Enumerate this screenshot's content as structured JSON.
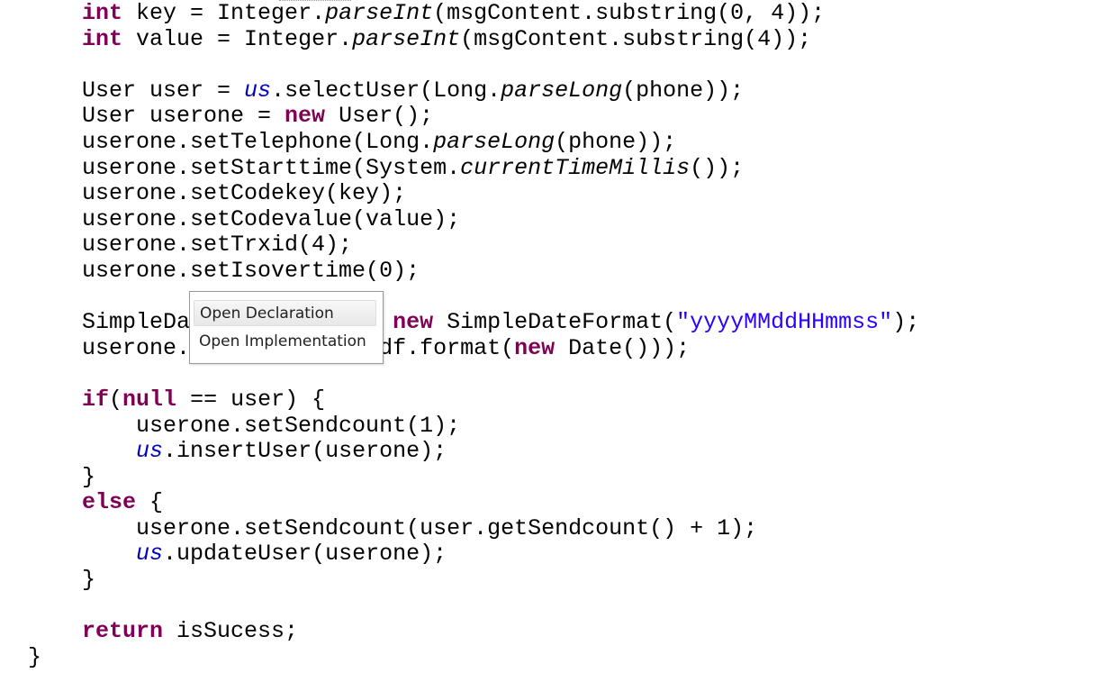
{
  "code_lines": [
    [
      [
        "kw",
        "int"
      ],
      [
        "",
        "    key = Integer."
      ],
      [
        "static",
        "parseInt"
      ],
      [
        "",
        "(msgContent.substring(0, 4));"
      ]
    ],
    [
      [
        "",
        "    "
      ],
      [
        "kw",
        "int"
      ],
      [
        "",
        " value = Integer."
      ],
      [
        "static",
        "parseInt"
      ],
      [
        "",
        "(msgContent.substring(4));"
      ]
    ],
    [],
    [
      [
        "",
        "    User user = "
      ],
      [
        "field",
        "us"
      ],
      [
        "",
        ".selectUser(Long."
      ],
      [
        "static",
        "parseLong"
      ],
      [
        "",
        "(phone));"
      ]
    ],
    [
      [
        "",
        "    User userone = "
      ],
      [
        "kw",
        "new"
      ],
      [
        "",
        " User();"
      ]
    ],
    [
      [
        "",
        "    userone.setTelephone(Long."
      ],
      [
        "static",
        "parseLong"
      ],
      [
        "",
        "(phone));"
      ]
    ],
    [
      [
        "",
        "    userone.setStarttime(System."
      ],
      [
        "static",
        "currentTimeMillis"
      ],
      [
        "",
        "());"
      ]
    ],
    [
      [
        "",
        "    userone.setCodekey(key);"
      ]
    ],
    [
      [
        "",
        "    userone.setCodevalue(value);"
      ]
    ],
    [
      [
        "",
        "    userone.setTrxid(4);"
      ]
    ],
    [
      [
        "",
        "    userone.setIsovertime(0);"
      ]
    ],
    [],
    [
      [
        "",
        "    SimpleDateFormat sdf = "
      ],
      [
        "kw",
        "new"
      ],
      [
        "",
        " SimpleDateFormat("
      ],
      [
        "str",
        "\"yyyyMMddHHmmss\""
      ],
      [
        "",
        ");"
      ]
    ],
    [
      [
        "",
        "    userone.setStarttime(sdf.format("
      ],
      [
        "kw",
        "new"
      ],
      [
        "",
        " Date()));"
      ]
    ],
    [],
    [
      [
        "",
        "    "
      ],
      [
        "kw",
        "if"
      ],
      [
        "",
        "("
      ],
      [
        "kw",
        "null"
      ],
      [
        "",
        " == user) {"
      ]
    ],
    [
      [
        "",
        "        userone.setSendcount(1);"
      ]
    ],
    [
      [
        "",
        "        "
      ],
      [
        "field",
        "us"
      ],
      [
        "",
        ".insertUser(userone);"
      ]
    ],
    [
      [
        "",
        "    }"
      ]
    ],
    [
      [
        "",
        "    "
      ],
      [
        "kw",
        "else"
      ],
      [
        "",
        " {"
      ]
    ],
    [
      [
        "",
        "        userone.setSendcount(user.getSendcount() + 1);"
      ]
    ],
    [
      [
        "",
        "        "
      ],
      [
        "field",
        "us"
      ],
      [
        "",
        ".updateUser(userone);"
      ]
    ],
    [
      [
        "",
        "    }"
      ]
    ],
    [],
    [
      [
        "",
        "    "
      ],
      [
        "kw",
        "return"
      ],
      [
        "",
        " isSucess;"
      ]
    ],
    [
      [
        "",
        "}"
      ]
    ]
  ],
  "context_menu": {
    "items": [
      {
        "label": "Open Declaration",
        "selected": true
      },
      {
        "label": "Open Implementation",
        "selected": false
      }
    ]
  }
}
